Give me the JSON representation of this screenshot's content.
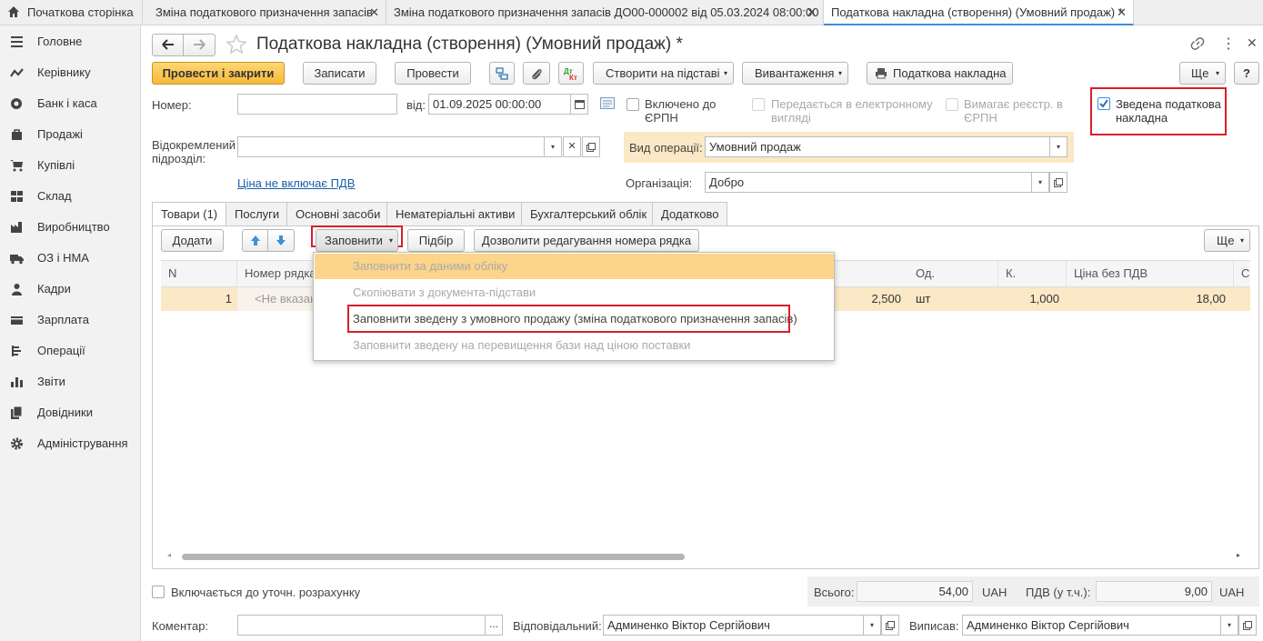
{
  "tabs": [
    {
      "label": "Початкова сторінка",
      "closable": false
    },
    {
      "label": "Зміна податкового призначення запасів",
      "closable": true
    },
    {
      "label": "Зміна податкового призначення запасів ДО00-000002 від 05.03.2024 08:00:00",
      "closable": true
    },
    {
      "label": "Податкова накладна (створення) (Умовний продаж) *",
      "closable": true,
      "active": true
    }
  ],
  "sidebar": {
    "items": [
      {
        "label": "Головне",
        "icon": "menu-icon"
      },
      {
        "label": "Керівнику",
        "icon": "chart-line-icon"
      },
      {
        "label": "Банк і каса",
        "icon": "coin-icon"
      },
      {
        "label": "Продажі",
        "icon": "bag-icon"
      },
      {
        "label": "Купівлі",
        "icon": "cart-icon"
      },
      {
        "label": "Склад",
        "icon": "warehouse-icon"
      },
      {
        "label": "Виробництво",
        "icon": "factory-icon"
      },
      {
        "label": "ОЗ і НМА",
        "icon": "truck-icon"
      },
      {
        "label": "Кадри",
        "icon": "person-icon"
      },
      {
        "label": "Зарплата",
        "icon": "wallet-icon"
      },
      {
        "label": "Операції",
        "icon": "operations-icon"
      },
      {
        "label": "Звіти",
        "icon": "bar-chart-icon"
      },
      {
        "label": "Довідники",
        "icon": "books-icon"
      },
      {
        "label": "Адміністрування",
        "icon": "gear-icon"
      }
    ]
  },
  "form": {
    "title": "Податкова накладна (створення) (Умовний продаж) *",
    "toolbar": {
      "post_close": "Провести і закрити",
      "save": "Записати",
      "post": "Провести",
      "create_based": "Створити на підставі",
      "export": "Вивантаження",
      "print_tax_invoice": "Податкова накладна",
      "more": "Ще",
      "help": "?"
    },
    "number_label": "Номер:",
    "number_value": "",
    "date_label": "від:",
    "date_value": "01.09.2025 00:00:00",
    "erpn_included": "Включено до ЄРПН",
    "electronic": "Передається в електронному вигляді",
    "requires_registration": "Вимагає реєстр. в ЄРПН",
    "consolidated": "Зведена податкова накладна",
    "subdivision_label": "Відокремлений підрозділ:",
    "subdivision_value": "",
    "operation_label": "Вид операції:",
    "operation_value": "Умовний продаж",
    "price_link": "Ціна не включає ПДВ",
    "org_label": "Організація:",
    "org_value": "Добро"
  },
  "doc_tabs": [
    "Товари (1)",
    "Послуги",
    "Основні засоби",
    "Нематеріальні активи",
    "Бухгалтерський облік",
    "Додатково"
  ],
  "table_toolbar": {
    "add": "Додати",
    "fill": "Заповнити",
    "pick": "Підбір",
    "allow_edit": "Дозволити редагування номера рядка",
    "more": "Ще"
  },
  "table": {
    "headers": {
      "n": "N",
      "row_number": "Номер рядка",
      "unit": "Од.",
      "k": "К.",
      "price": "Ціна без ПДВ",
      "cut": "С"
    },
    "rows": [
      {
        "n": "1",
        "row_number": "<Не вказан",
        "qty": "2,500",
        "unit": "шт",
        "k": "1,000",
        "price": "18,00"
      }
    ]
  },
  "fill_menu": [
    "Заповнити за даними обліку",
    "Скопіювати з документа-підстави",
    "Заповнити зведену з умовного продажу (зміна податкового призначення запасів)",
    "Заповнити зведену на перевищення бази над ціною поставки"
  ],
  "footer": {
    "include_label": "Включається до уточн. розрахунку",
    "total_label": "Всього:",
    "total_value": "54,00",
    "currency": "UAH",
    "vat_label": "ПДВ (у т.ч.):",
    "vat_value": "9,00",
    "vat_currency": "UAH",
    "comment_label": "Коментар:",
    "comment_value": "",
    "comment_btn": "...",
    "responsible_label": "Відповідальний:",
    "responsible_value": "Админенко Віктор Сергійович",
    "issued_label": "Виписав:",
    "issued_value": "Админенко Віктор Сергійович"
  },
  "colors": {
    "accent_yellow": "#f5b93a",
    "highlight_red": "#d81e2c",
    "row_highlight": "#fbe8c6",
    "link_blue": "#1a5fa8"
  }
}
